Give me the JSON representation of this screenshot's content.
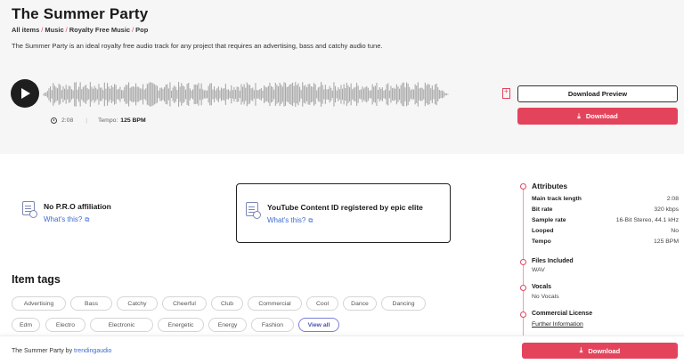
{
  "track": {
    "title": "The Summer Party",
    "breadcrumb": [
      "All items",
      "Music",
      "Royalty Free Music",
      "Pop"
    ],
    "description": "The Summer Party is an ideal royalty free audio track for any project that requires an advertising, bass and catchy audio tune.",
    "duration": "2:08",
    "tempo_label": "Tempo:",
    "tempo_value": "125 BPM"
  },
  "actions": {
    "preview_label": "Download Preview",
    "download_label": "Download"
  },
  "licensing": {
    "pro_title": "No P.R.O affiliation",
    "pro_link": "What's this?",
    "yt_title": "YouTube Content ID registered by epic elite",
    "yt_link": "What's this?"
  },
  "tags": {
    "title": "Item tags",
    "items": [
      "Advertising",
      "Bass",
      "Catchy",
      "Cheerful",
      "Club",
      "Commercial",
      "Cool",
      "Dance",
      "Dancing",
      "Edm",
      "Electro",
      "Electronic",
      "Energetic",
      "Energy",
      "Fashion"
    ],
    "view_all": "View all"
  },
  "attributes": {
    "title": "Attributes",
    "rows": [
      {
        "k": "Main track length",
        "v": "2:08"
      },
      {
        "k": "Bit rate",
        "v": "320 kbps"
      },
      {
        "k": "Sample rate",
        "v": "16-Bit Stereo, 44.1 kHz"
      },
      {
        "k": "Looped",
        "v": "No"
      },
      {
        "k": "Tempo",
        "v": "125 BPM"
      }
    ],
    "files_title": "Files Included",
    "files_value": "WAV",
    "vocals_title": "Vocals",
    "vocals_value": "No Vocals",
    "license_title": "Commercial License",
    "license_link": "Further Information"
  },
  "footer": {
    "track": "The Summer Party by",
    "author": "trendingaudio",
    "download_label": "Download"
  },
  "colors": {
    "accent": "#e3445c",
    "link": "#3d6bd0"
  }
}
